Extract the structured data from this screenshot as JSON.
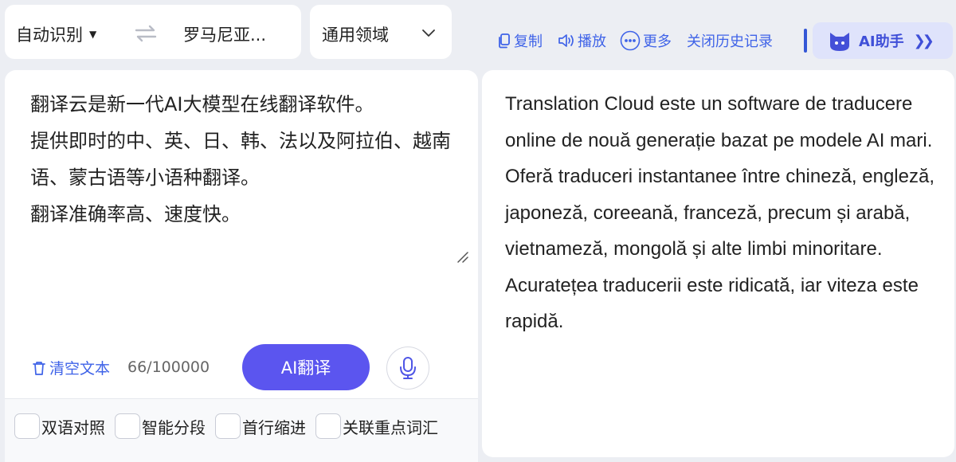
{
  "lang_bar": {
    "source_lang": "自动识别",
    "target_lang": "罗马尼亚..."
  },
  "domain": {
    "label": "通用领域"
  },
  "toolbar": {
    "copy": "复制",
    "play": "播放",
    "more": "更多",
    "history": "关闭历史记录",
    "ai_helper": "AI助手"
  },
  "source": {
    "text": "翻译云是新一代AI大模型在线翻译软件。\n提供即时的中、英、日、韩、法以及阿拉伯、越南语、蒙古语等小语种翻译。\n翻译准确率高、速度快。",
    "clear_label": "清空文本",
    "char_count": "66/100000",
    "translate_label": "AI翻译"
  },
  "options": [
    {
      "label": "双语对照",
      "checked": false
    },
    {
      "label": "智能分段",
      "checked": false
    },
    {
      "label": "首行缩进",
      "checked": false
    },
    {
      "label": "关联重点词汇",
      "checked": false
    }
  ],
  "result": {
    "text": "Translation Cloud este un software de traducere online de nouă generație bazat pe modele AI mari.\nOferă traduceri instantanee între chineză, engleză, japoneză, coreeană, franceză, precum și arabă, vietnameză, mongolă și alte limbi minoritare.\nAcuratețea traducerii este ridicată, iar viteza este rapidă."
  },
  "icons": {
    "copy": "copy-icon",
    "play": "speaker-icon",
    "more": "more-dots-icon",
    "clear": "trash-icon",
    "mic": "microphone-icon",
    "swap": "swap-arrows-icon",
    "ai": "ai-cat-avatar-icon"
  },
  "colors": {
    "accent": "#3f63e8",
    "primary_button": "#5b55ef",
    "ai_helper_bg": "#dfe3fb",
    "background": "#eceef3"
  }
}
